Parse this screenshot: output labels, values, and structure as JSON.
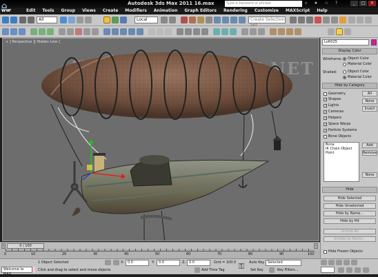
{
  "window": {
    "title": "Autodesk 3ds Max  2011     16.max",
    "search_placeholder": "Type a keyword or phrase",
    "watermark_url": "www.blue1000.com"
  },
  "menu": [
    "Edit",
    "Tools",
    "Group",
    "Views",
    "Create",
    "Modifiers",
    "Animation",
    "Graph Editors",
    "Rendering",
    "Customize",
    "MAXScript",
    "Help"
  ],
  "toolbar": {
    "selection_filter": "All",
    "coord_system": "Local",
    "named_selection_placeholder": "Create Selection Set"
  },
  "viewport": {
    "label": "+ ] Perspective ][ Hidden Line ]",
    "watermark": "騰龍視覺 WWW.TLVI.NET"
  },
  "command_panel": {
    "object_name": "Loft025",
    "display_color": {
      "header": "Display Color",
      "wireframe_label": "Wireframe:",
      "shaded_label": "Shaded:",
      "object_color": "Object Color",
      "material_color": "Material Color"
    },
    "hide_by_category": {
      "header": "Hide by Category",
      "categories": [
        "Geometry",
        "Shapes",
        "Lights",
        "Cameras",
        "Helpers",
        "Space Warps",
        "Particle Systems",
        "Bone Objects"
      ],
      "all_label": "All",
      "none_label": "None",
      "invert_label": "Invert",
      "list_items": [
        "Bone",
        "IK Chain Object",
        "Point"
      ],
      "add_label": "Add",
      "remove_label": "Remove",
      "none2_label": "None"
    },
    "hide": {
      "header": "Hide",
      "buttons": [
        "Hide Selected",
        "Hide Unselected",
        "Hide by Name...",
        "Hide by Hit"
      ],
      "disabled_buttons": [
        "Unhide All",
        "Unhide by Name..."
      ],
      "hide_frozen_label": "Hide Frozen Objects"
    }
  },
  "timeline": {
    "frame_readout": "0 / 100",
    "ticks": [
      "0",
      "10",
      "20",
      "30",
      "40",
      "50",
      "60",
      "70",
      "80",
      "90",
      "100"
    ]
  },
  "status": {
    "maxscript_label": "Welcome to MAX",
    "selection_text": "1 Object Selected",
    "prompt_text": "Click and drag to select and move objects",
    "x_label": "X:",
    "x_value": "0.0",
    "y_label": "Y:",
    "y_value": "0.0",
    "z_label": "Z:",
    "z_value": "0.0",
    "grid_text": "Grid = 100.0",
    "add_time_tag": "Add Time Tag",
    "auto_key": "Auto Key",
    "set_key": "Set Key",
    "key_mode": "Selected",
    "key_filters": "Key Filters..."
  },
  "colors": {
    "object_color_swatch": "#e0149e",
    "viewport_bg": "#6d6d6d",
    "balloon": "#7a5a45",
    "hull": "#8a8a6e",
    "gizmo_x": "#e02020",
    "gizmo_y": "#20c020",
    "gizmo_z": "#2040e0"
  }
}
